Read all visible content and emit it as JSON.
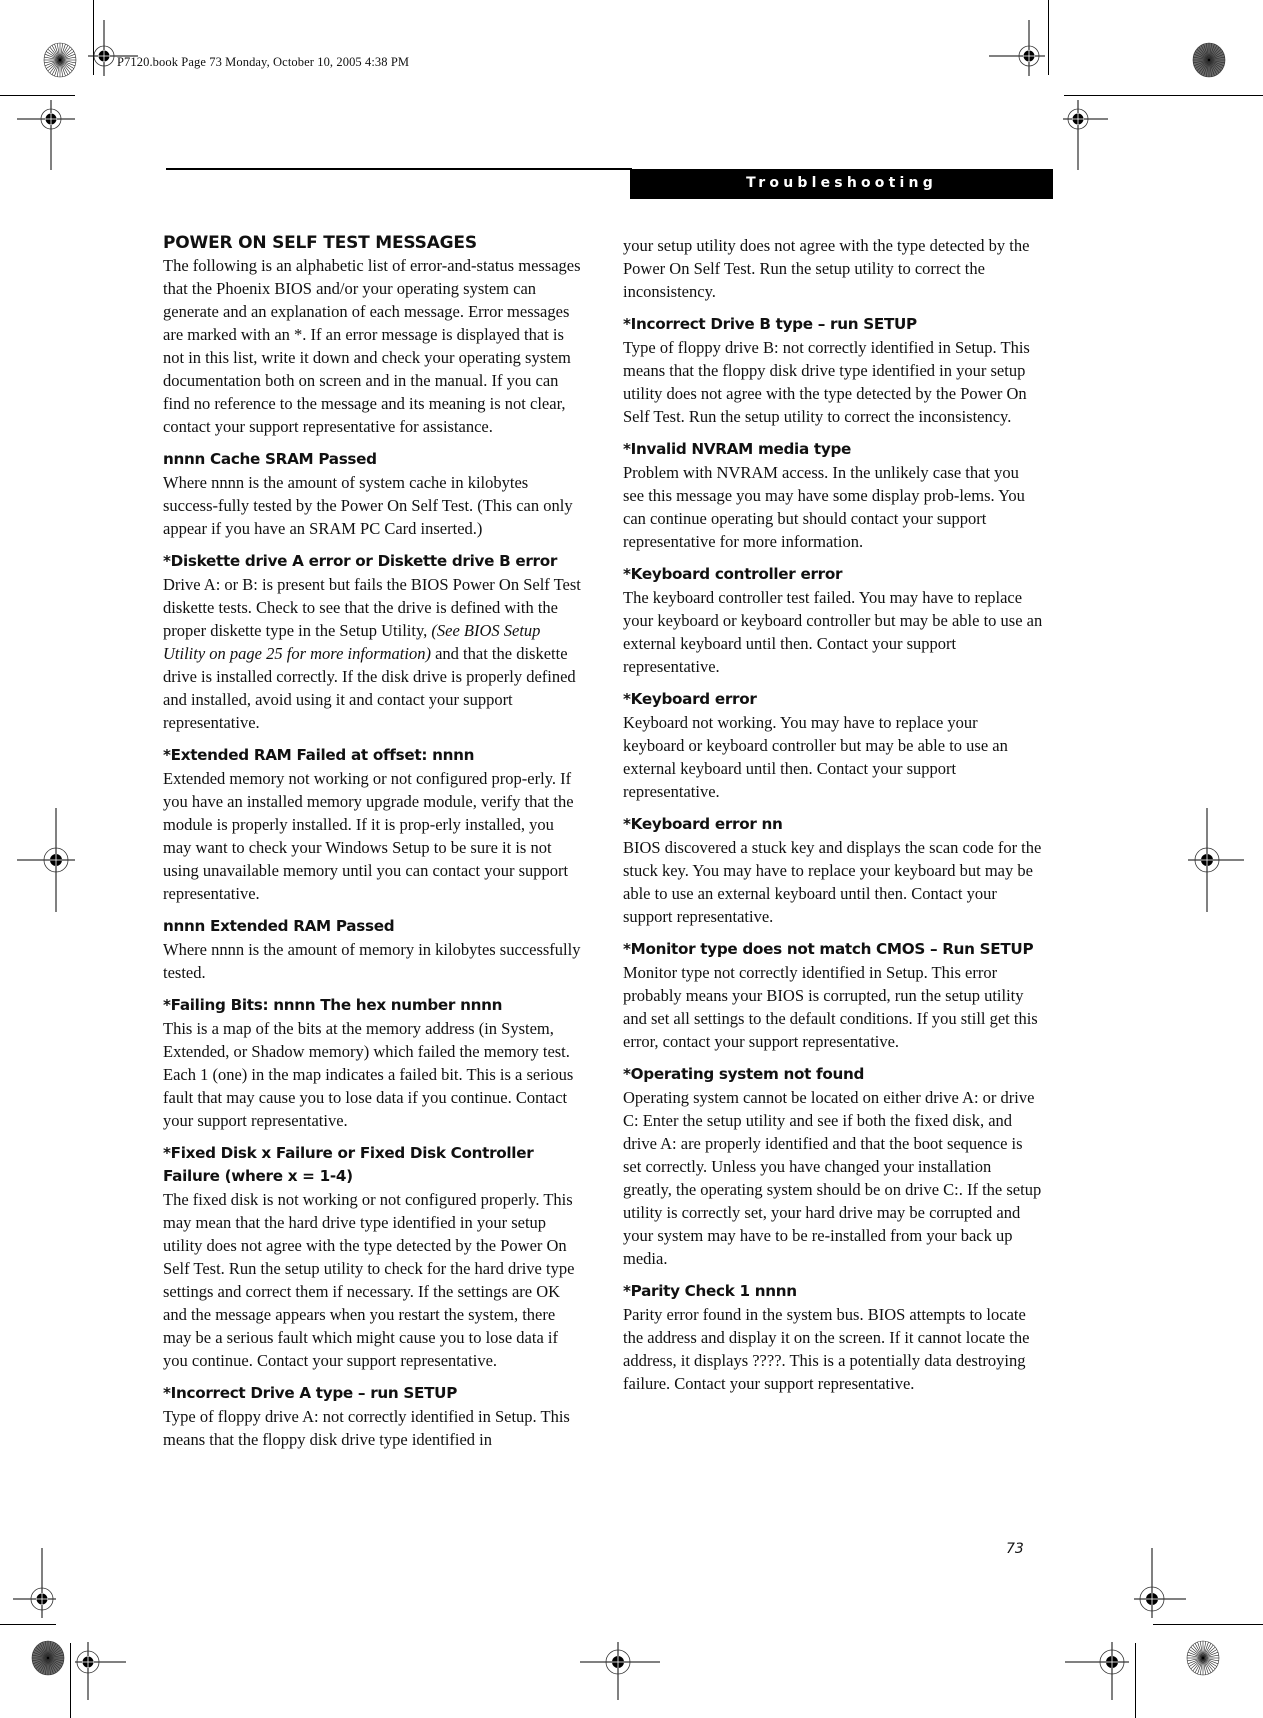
{
  "slug": "P7120.book  Page 73  Monday, October 10, 2005  4:38 PM",
  "header": {
    "title": "Troubleshooting"
  },
  "section": {
    "title": "POWER ON SELF TEST MESSAGES",
    "intro": "The following is an alphabetic list of error-and-status messages that the Phoenix BIOS and/or your operating system can generate and an explanation of each message. Error messages are marked with an *. If an error message is displayed that is not in this list, write it down and check your operating system documentation both on screen and in the manual. If you can find no reference to the message and its meaning is not clear, contact your support representative for assistance."
  },
  "entries_left": [
    {
      "heading": "nnnn Cache SRAM Passed",
      "body": "Where nnnn is the amount of system cache in kilobytes success-fully tested by the Power On Self Test. (This can only appear if you have an SRAM PC Card inserted.)"
    },
    {
      "heading": "*Diskette drive A error or Diskette drive B error",
      "body_pre": "Drive A: or B: is present but fails the BIOS Power On Self Test diskette tests. Check to see that the drive is defined with the proper diskette type in the Setup Utility, ",
      "body_italic": "(See BIOS Setup Utility on page 25 for more information)",
      "body_post": " and that the diskette drive is installed correctly. If the disk drive is properly defined and installed, avoid using it and contact your support representative."
    },
    {
      "heading": "*Extended RAM Failed at offset: nnnn",
      "body": "Extended memory not working or not configured prop-erly. If you have an installed memory upgrade module, verify that the module is properly installed. If it is prop-erly installed, you may want to check your Windows Setup to be sure it is not using unavailable memory until you can contact your support representative."
    },
    {
      "heading": "nnnn Extended RAM Passed",
      "body": "Where nnnn is the amount of memory in kilobytes successfully tested."
    },
    {
      "heading": "*Failing Bits: nnnn The hex number nnnn",
      "body": "This is a map of the bits at the memory address (in System, Extended, or Shadow memory) which failed the memory test. Each 1 (one) in the map indicates a failed bit. This is a serious fault that may cause you to lose data if you continue. Contact your support representative."
    },
    {
      "heading": "*Fixed Disk x Failure or Fixed Disk Controller Failure (where x = 1-4)",
      "body": "The fixed disk is not working or not configured properly. This may mean that the hard drive type identified in your setup utility does not agree with the type detected by the Power On Self Test. Run the setup utility to check for the hard drive type settings and correct them if necessary. If the settings are OK and the message appears when you restart the system, there may be a serious fault which might cause you to lose data if you continue. Contact your support representative."
    },
    {
      "heading": "*Incorrect Drive A type – run SETUP",
      "body": "Type of floppy drive A: not correctly identified in Setup. This means that the floppy disk drive type identified in"
    }
  ],
  "continuation_right": "your setup utility does not agree with the type detected by the Power On Self Test. Run the setup utility to correct the inconsistency.",
  "entries_right": [
    {
      "heading": "*Incorrect Drive B type – run SETUP",
      "body": "Type of floppy drive B: not correctly identified in Setup. This means that the floppy disk drive type identified in your setup utility does not agree with the type detected by the Power On Self Test. Run the setup utility to correct the inconsistency."
    },
    {
      "heading": "*Invalid NVRAM media type",
      "body": "Problem with NVRAM access. In the unlikely case that you see this message you may have some display prob-lems. You can continue operating but should contact your support representative for more information."
    },
    {
      "heading": "*Keyboard controller error",
      "body": "The keyboard controller test failed. You may have to replace your keyboard or keyboard controller but may be able to use an external keyboard until then. Contact your support representative."
    },
    {
      "heading": "*Keyboard error",
      "body": "Keyboard not working. You may have to replace your keyboard or keyboard controller but may be able to use an external keyboard until then. Contact your support representative."
    },
    {
      "heading": "*Keyboard error nn",
      "body": "BIOS discovered a stuck key and displays the scan code for the stuck key. You may have to replace your keyboard but may be able to use an external keyboard until then. Contact your support representative."
    },
    {
      "heading": "*Monitor type does not match CMOS – Run SETUP",
      "body": "Monitor type not correctly identified in Setup. This error probably means your BIOS is corrupted, run the setup utility and set all settings to the default conditions. If you still get this error, contact your support representative."
    },
    {
      "heading": "*Operating system not found",
      "body": "Operating system cannot be located on either drive A: or drive C: Enter the setup utility and see if both the fixed disk, and drive A: are properly identified and that the boot sequence is set correctly. Unless you have changed your installation greatly, the operating system should be on drive C:. If the setup utility is correctly set, your hard drive may be corrupted and your system may have to be re-installed from your back up media."
    },
    {
      "heading": "*Parity Check 1 nnnn",
      "body": "Parity error found in the system bus. BIOS attempts to locate the address and display it on the screen. If it cannot locate the address, it displays ????. This is a potentially data destroying failure. Contact your support representative."
    }
  ],
  "page_number": "73",
  "icons": {
    "registration_mark": "registration-crosshair-icon",
    "color_target": "starburst-target-icon"
  }
}
